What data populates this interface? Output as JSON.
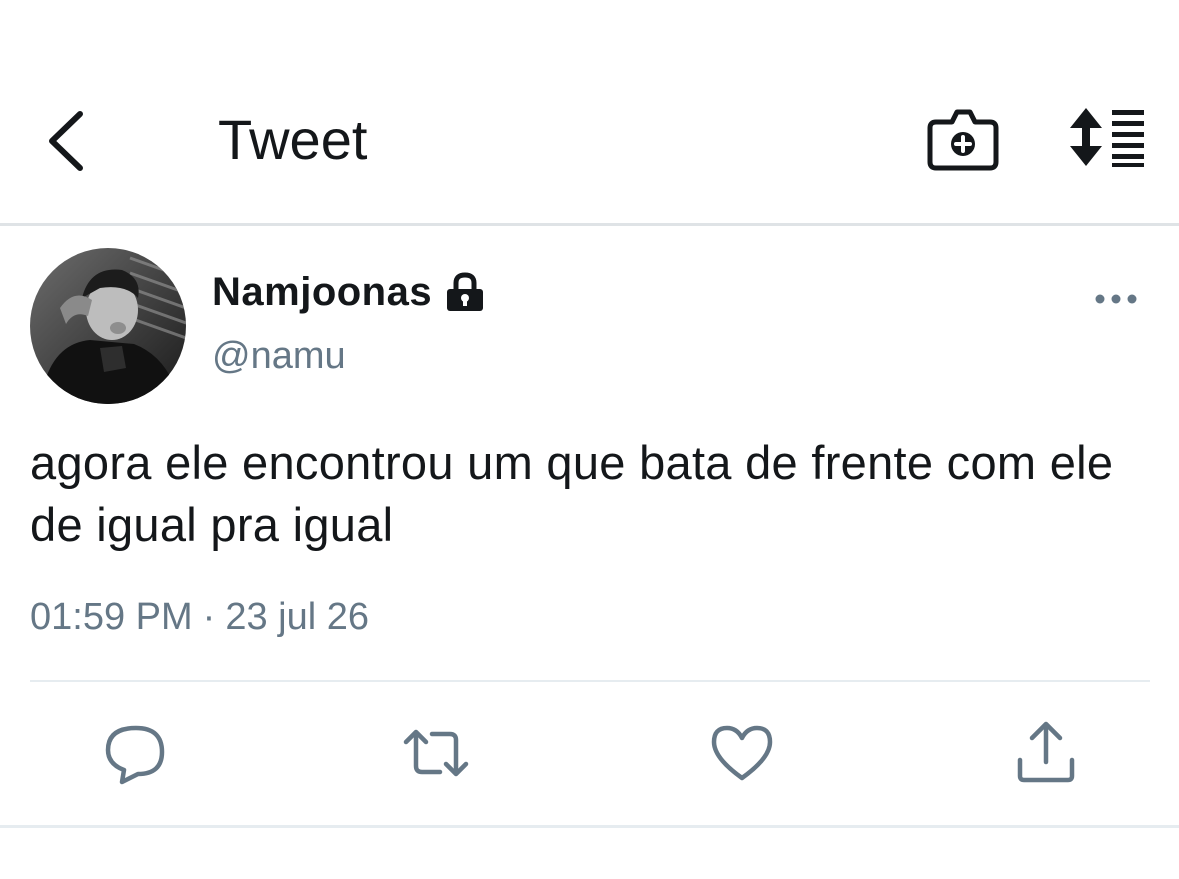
{
  "header": {
    "title": "Tweet",
    "back_icon": "chevron-left-icon",
    "camera_icon": "camera-plus-icon",
    "sort_icon": "sort-list-icon"
  },
  "tweet": {
    "display_name": "Namjoonas",
    "protected": true,
    "handle": "@namu",
    "text": "agora ele encontrou um que bata de frente com ele de igual pra igual",
    "time": "01:59 PM",
    "separator": "·",
    "date": "23 jul 26"
  },
  "actions": [
    "reply",
    "retweet",
    "like",
    "share"
  ],
  "colors": {
    "text_primary": "#14171a",
    "text_secondary": "#657786",
    "icon_gray": "#657786",
    "divider": "#e6ecf0"
  }
}
